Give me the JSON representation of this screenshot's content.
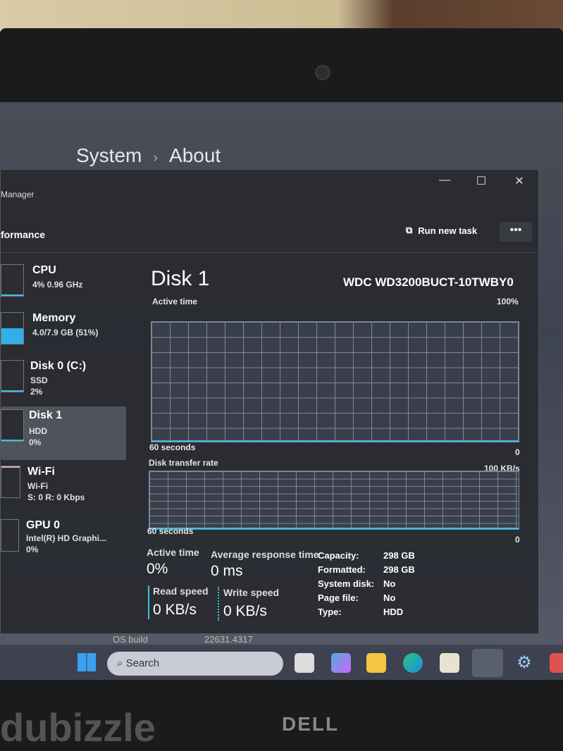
{
  "settings": {
    "breadcrumb": [
      "System",
      "About"
    ],
    "os_build_label": "OS build",
    "os_build_value": "22631.4317"
  },
  "window": {
    "title": "Manager",
    "minimize": "—",
    "maximize": "☐",
    "close": "✕"
  },
  "header": {
    "section": "formance",
    "run_new_task": "Run new task",
    "more": "•••"
  },
  "sidebar": {
    "items": [
      {
        "name": "CPU",
        "sub1": "4% 0.96 GHz",
        "sub2": ""
      },
      {
        "name": "Memory",
        "sub1": "4.0/7.9 GB (51%)",
        "sub2": ""
      },
      {
        "name": "Disk 0 (C:)",
        "sub1": "SSD",
        "sub2": "2%"
      },
      {
        "name": "Disk 1",
        "sub1": "HDD",
        "sub2": "0%"
      },
      {
        "name": "Wi-Fi",
        "sub1": "Wi-Fi",
        "sub2": "S: 0 R: 0 Kbps"
      },
      {
        "name": "GPU 0",
        "sub1": "Intel(R) HD Graphi...",
        "sub2": "0%"
      }
    ]
  },
  "selected_item": "Disk 1",
  "main": {
    "title": "Disk 1",
    "model": "WDC WD3200BUCT-10TWBY0",
    "graph1": {
      "label": "Active time",
      "max": "100%",
      "time": "60 seconds",
      "min": "0"
    },
    "graph2": {
      "label": "Disk transfer rate",
      "max": "100 KB/s",
      "time": "60 seconds",
      "min": "0"
    },
    "stats": {
      "active_time_label": "Active time",
      "active_time": "0%",
      "avg_resp_label": "Average response time",
      "avg_resp": "0 ms",
      "read_label": "Read speed",
      "read": "0 KB/s",
      "write_label": "Write speed",
      "write": "0 KB/s"
    },
    "props": [
      {
        "k": "Capacity:",
        "v": "298 GB"
      },
      {
        "k": "Formatted:",
        "v": "298 GB"
      },
      {
        "k": "System disk:",
        "v": "No"
      },
      {
        "k": "Page file:",
        "v": "No"
      },
      {
        "k": "Type:",
        "v": "HDD"
      }
    ]
  },
  "taskbar": {
    "search": "Search"
  },
  "bezel": {
    "brand": "DELL",
    "watermark": "dubizzle"
  },
  "colors": {
    "accent": "#3ec0e8",
    "window_bg": "#2a2c32"
  }
}
